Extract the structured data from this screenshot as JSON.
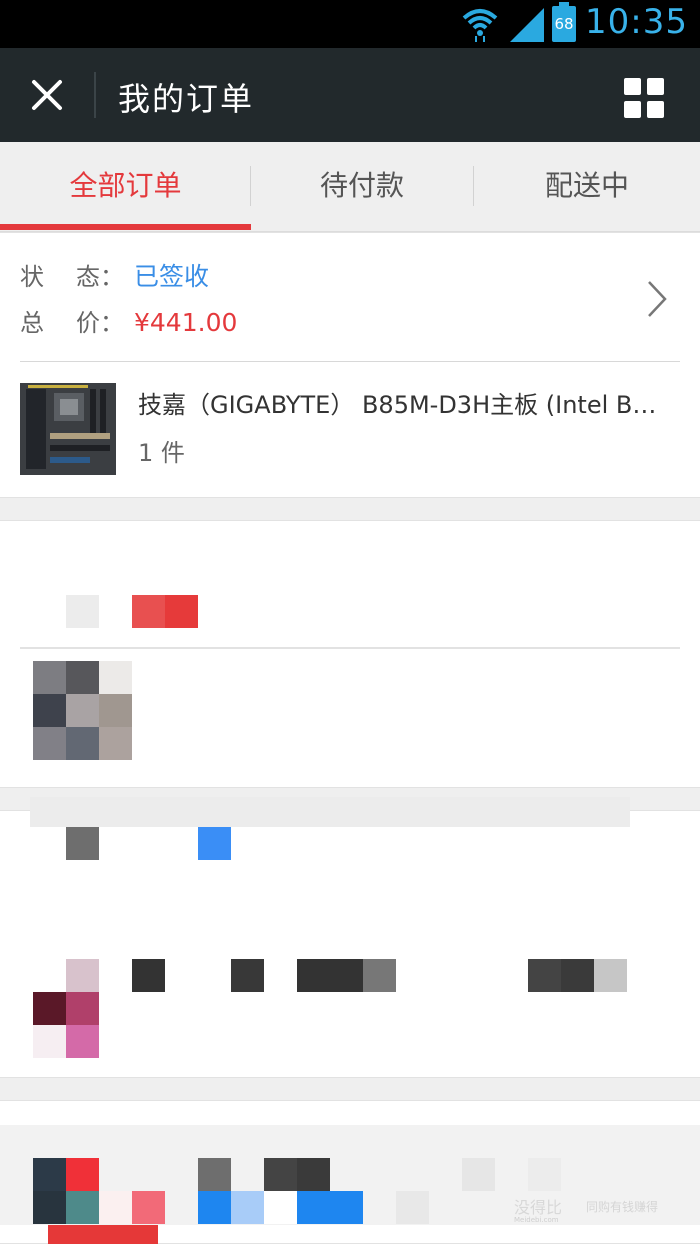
{
  "status_bar": {
    "battery": "68",
    "time": "10:35",
    "wifi_icon": "wifi-icon",
    "signal_icon": "signal-icon",
    "battery_icon": "battery-icon"
  },
  "title_bar": {
    "title": "我的订单",
    "close_icon": "close-icon",
    "menu_icon": "grid-menu-icon"
  },
  "tabs": [
    {
      "label": "全部订单",
      "active": true
    },
    {
      "label": "待付款",
      "active": false
    },
    {
      "label": "配送中",
      "active": false
    }
  ],
  "orders": [
    {
      "status_label_1": "状",
      "status_label_2": "态",
      "status_colon": "：",
      "status": "已签收",
      "price_label_1": "总",
      "price_label_2": "价",
      "price_colon": "：",
      "price": "¥441.00",
      "product_name": "技嘉（GIGABYTE） B85M-D3H主板 (Intel B…",
      "quantity": "1 件"
    }
  ],
  "colors": {
    "accent": "#e4393c",
    "status_blue": "#3a8ee6",
    "title_bar_bg": "#22292c"
  },
  "watermark": {
    "brand": "没得比",
    "site": "Meidebi.com",
    "slogan": "同购有钱赚得"
  }
}
